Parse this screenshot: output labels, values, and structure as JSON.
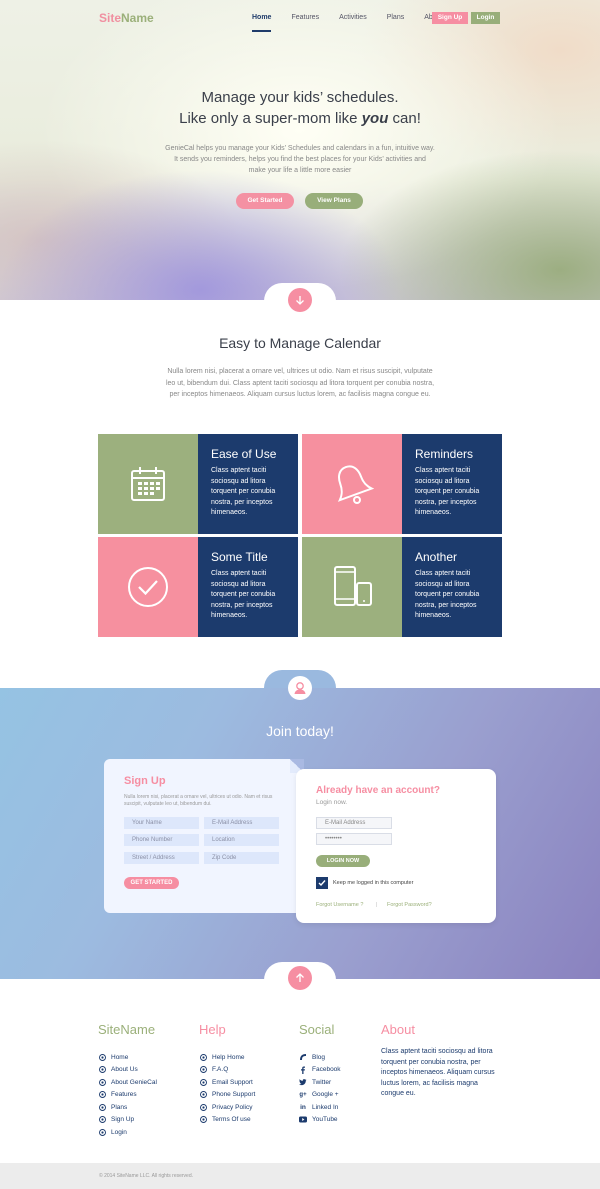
{
  "header": {
    "brand_part1": "Site",
    "brand_part2": "Name",
    "nav": [
      "Home",
      "Features",
      "Activities",
      "Plans",
      "About"
    ],
    "signup_label": "Sign Up",
    "login_label": "Login"
  },
  "hero": {
    "title_line1": "Manage your kids’ schedules.",
    "title_line2_pre": "Like only a super-mom like ",
    "title_line2_em": "you",
    "title_line2_post": " can!",
    "description": "GenieCal helps you manage your Kids’ Schedules and calendars in a fun, intuitive way. It sends you reminders, helps you find the best places for your Kids’ activities and make your life a little more easier",
    "get_started_label": "Get Started",
    "view_plans_label": "View Plans"
  },
  "features_section": {
    "title": "Easy to Manage Calendar",
    "description": "Nulla lorem nisi, placerat a ornare vel, ultrices ut odio. Nam et risus suscipit, vulputate leo ut, bibendum dui. Class aptent taciti sociosqu ad litora torquent per conubia nostra, per inceptos himenaeos. Aliquam cursus luctus lorem, ac facilisis magna congue eu.",
    "items": [
      {
        "title": "Ease of Use",
        "text": "Class aptent taciti sociosqu ad litora torquent per conubia nostra, per inceptos himenaeos.",
        "icon": "calendar-icon",
        "color": "#9cb07e"
      },
      {
        "title": "Reminders",
        "text": "Class aptent taciti sociosqu ad litora torquent per conubia nostra, per inceptos himenaeos.",
        "icon": "bell-icon",
        "color": "#f6909f"
      },
      {
        "title": "Some Title",
        "text": "Class aptent taciti sociosqu ad litora torquent per conubia nostra, per inceptos himenaeos.",
        "icon": "checkmark-circle-icon",
        "color": "#f6909f"
      },
      {
        "title": "Another",
        "text": "Class aptent taciti sociosqu ad litora torquent per conubia nostra, per inceptos himenaeos.",
        "icon": "devices-icon",
        "color": "#9cb07e"
      }
    ]
  },
  "join": {
    "title": "Join today!",
    "signup": {
      "title": "Sign Up",
      "description": "Nulla lorem nisi, placerat a ornare vel, ultrices ut odio. Nam et risus suscipit, vulputate leo ut, bibendum dui.",
      "fields": [
        "Your Name",
        "E-Mail Address",
        "Phone Number",
        "Location",
        "Street / Address",
        "Zip Code"
      ],
      "button_label": "GET STARTED"
    },
    "login": {
      "title": "Already have an account?",
      "subtitle": "Login now.",
      "email_placeholder": "E-Mail Address",
      "password_value": "••••••••",
      "button_label": "LOGIN NOW",
      "keep_logged_label": "Keep me logged in this computer",
      "forgot_username": "Forgot Username ?",
      "separator": "|",
      "forgot_password": "Forgot Password?"
    }
  },
  "footer": {
    "col1": {
      "title": "SiteName",
      "items": [
        "Home",
        "About Us",
        "About GenieCal",
        "Features",
        "Plans",
        "Sign Up",
        "Login"
      ]
    },
    "col2": {
      "title": "Help",
      "items": [
        "Help Home",
        "F.A.Q",
        "Email Support",
        "Phone Support",
        "Privacy Policy",
        "Terms Of use"
      ]
    },
    "col3": {
      "title": "Social",
      "items": [
        "Blog",
        "Facebook",
        "Twitter",
        "Google +",
        "Linked In",
        "YouTube"
      ]
    },
    "col4": {
      "title": "About",
      "text": "Class aptent taciti sociosqu ad litora torquent per conubia nostra, per inceptos himenaeos. Aliquam cursus luctus lorem, ac facilisis magna congue eu."
    },
    "copyright": "© 2014 SiteName LLC. All rights reserved."
  },
  "colors": {
    "pink": "#f68ea2",
    "green": "#98ae7a",
    "navy": "#1c3b6d"
  }
}
